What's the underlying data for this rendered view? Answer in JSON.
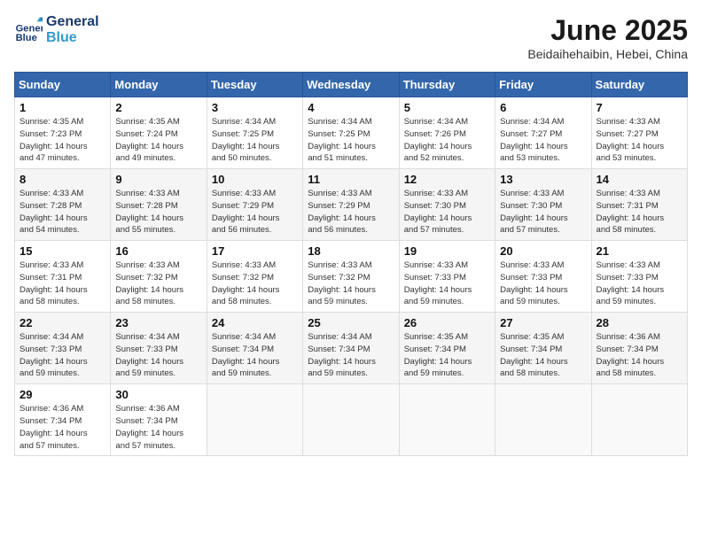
{
  "header": {
    "logo_line1": "General",
    "logo_line2": "Blue",
    "month_title": "June 2025",
    "location": "Beidaihehaibin, Hebei, China"
  },
  "weekdays": [
    "Sunday",
    "Monday",
    "Tuesday",
    "Wednesday",
    "Thursday",
    "Friday",
    "Saturday"
  ],
  "weeks": [
    [
      {
        "day": "1",
        "info": "Sunrise: 4:35 AM\nSunset: 7:23 PM\nDaylight: 14 hours\nand 47 minutes."
      },
      {
        "day": "2",
        "info": "Sunrise: 4:35 AM\nSunset: 7:24 PM\nDaylight: 14 hours\nand 49 minutes."
      },
      {
        "day": "3",
        "info": "Sunrise: 4:34 AM\nSunset: 7:25 PM\nDaylight: 14 hours\nand 50 minutes."
      },
      {
        "day": "4",
        "info": "Sunrise: 4:34 AM\nSunset: 7:25 PM\nDaylight: 14 hours\nand 51 minutes."
      },
      {
        "day": "5",
        "info": "Sunrise: 4:34 AM\nSunset: 7:26 PM\nDaylight: 14 hours\nand 52 minutes."
      },
      {
        "day": "6",
        "info": "Sunrise: 4:34 AM\nSunset: 7:27 PM\nDaylight: 14 hours\nand 53 minutes."
      },
      {
        "day": "7",
        "info": "Sunrise: 4:33 AM\nSunset: 7:27 PM\nDaylight: 14 hours\nand 53 minutes."
      }
    ],
    [
      {
        "day": "8",
        "info": "Sunrise: 4:33 AM\nSunset: 7:28 PM\nDaylight: 14 hours\nand 54 minutes."
      },
      {
        "day": "9",
        "info": "Sunrise: 4:33 AM\nSunset: 7:28 PM\nDaylight: 14 hours\nand 55 minutes."
      },
      {
        "day": "10",
        "info": "Sunrise: 4:33 AM\nSunset: 7:29 PM\nDaylight: 14 hours\nand 56 minutes."
      },
      {
        "day": "11",
        "info": "Sunrise: 4:33 AM\nSunset: 7:29 PM\nDaylight: 14 hours\nand 56 minutes."
      },
      {
        "day": "12",
        "info": "Sunrise: 4:33 AM\nSunset: 7:30 PM\nDaylight: 14 hours\nand 57 minutes."
      },
      {
        "day": "13",
        "info": "Sunrise: 4:33 AM\nSunset: 7:30 PM\nDaylight: 14 hours\nand 57 minutes."
      },
      {
        "day": "14",
        "info": "Sunrise: 4:33 AM\nSunset: 7:31 PM\nDaylight: 14 hours\nand 58 minutes."
      }
    ],
    [
      {
        "day": "15",
        "info": "Sunrise: 4:33 AM\nSunset: 7:31 PM\nDaylight: 14 hours\nand 58 minutes."
      },
      {
        "day": "16",
        "info": "Sunrise: 4:33 AM\nSunset: 7:32 PM\nDaylight: 14 hours\nand 58 minutes."
      },
      {
        "day": "17",
        "info": "Sunrise: 4:33 AM\nSunset: 7:32 PM\nDaylight: 14 hours\nand 58 minutes."
      },
      {
        "day": "18",
        "info": "Sunrise: 4:33 AM\nSunset: 7:32 PM\nDaylight: 14 hours\nand 59 minutes."
      },
      {
        "day": "19",
        "info": "Sunrise: 4:33 AM\nSunset: 7:33 PM\nDaylight: 14 hours\nand 59 minutes."
      },
      {
        "day": "20",
        "info": "Sunrise: 4:33 AM\nSunset: 7:33 PM\nDaylight: 14 hours\nand 59 minutes."
      },
      {
        "day": "21",
        "info": "Sunrise: 4:33 AM\nSunset: 7:33 PM\nDaylight: 14 hours\nand 59 minutes."
      }
    ],
    [
      {
        "day": "22",
        "info": "Sunrise: 4:34 AM\nSunset: 7:33 PM\nDaylight: 14 hours\nand 59 minutes."
      },
      {
        "day": "23",
        "info": "Sunrise: 4:34 AM\nSunset: 7:33 PM\nDaylight: 14 hours\nand 59 minutes."
      },
      {
        "day": "24",
        "info": "Sunrise: 4:34 AM\nSunset: 7:34 PM\nDaylight: 14 hours\nand 59 minutes."
      },
      {
        "day": "25",
        "info": "Sunrise: 4:34 AM\nSunset: 7:34 PM\nDaylight: 14 hours\nand 59 minutes."
      },
      {
        "day": "26",
        "info": "Sunrise: 4:35 AM\nSunset: 7:34 PM\nDaylight: 14 hours\nand 59 minutes."
      },
      {
        "day": "27",
        "info": "Sunrise: 4:35 AM\nSunset: 7:34 PM\nDaylight: 14 hours\nand 58 minutes."
      },
      {
        "day": "28",
        "info": "Sunrise: 4:36 AM\nSunset: 7:34 PM\nDaylight: 14 hours\nand 58 minutes."
      }
    ],
    [
      {
        "day": "29",
        "info": "Sunrise: 4:36 AM\nSunset: 7:34 PM\nDaylight: 14 hours\nand 57 minutes."
      },
      {
        "day": "30",
        "info": "Sunrise: 4:36 AM\nSunset: 7:34 PM\nDaylight: 14 hours\nand 57 minutes."
      },
      {
        "day": "",
        "info": ""
      },
      {
        "day": "",
        "info": ""
      },
      {
        "day": "",
        "info": ""
      },
      {
        "day": "",
        "info": ""
      },
      {
        "day": "",
        "info": ""
      }
    ]
  ]
}
